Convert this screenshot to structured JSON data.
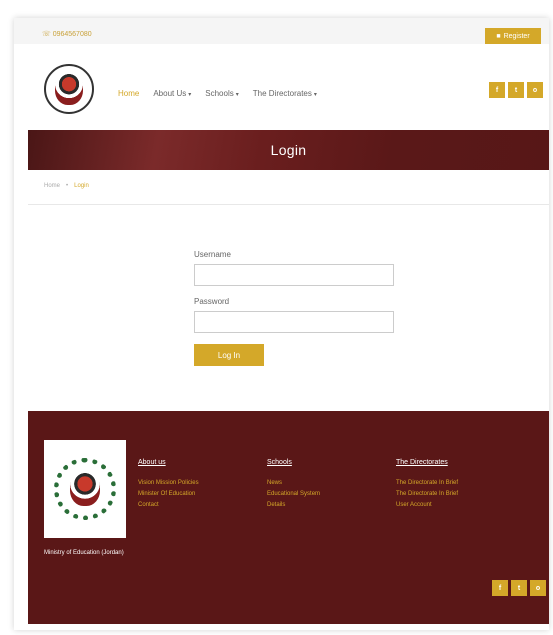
{
  "topbar": {
    "phone": "☏ 0964567080",
    "register_label": "Register"
  },
  "nav": {
    "items": [
      {
        "label": "Home",
        "active": true
      },
      {
        "label": "About Us",
        "caret": "▾"
      },
      {
        "label": "Schools",
        "caret": "▾"
      },
      {
        "label": "The Directorates",
        "caret": "▾"
      }
    ]
  },
  "social": [
    "f",
    "t",
    "o"
  ],
  "page": {
    "title": "Login"
  },
  "breadcrumb": {
    "home": "Home",
    "separator": "•",
    "current": "Login"
  },
  "login_form": {
    "username_label": "Username",
    "password_label": "Password",
    "username_value": "",
    "password_value": "",
    "submit_label": "Log In"
  },
  "footer": {
    "org_name": "Ministry of Education (Jordan)",
    "columns": [
      {
        "title": "About us",
        "links": [
          "Vision Mission Policies",
          "Minister Of Education",
          "Contact"
        ]
      },
      {
        "title": "Schools",
        "links": [
          "News",
          "Educational System",
          "Details"
        ]
      },
      {
        "title": "The Directorates",
        "links": [
          "The Directorate In Brief",
          "The Directorate In Brief",
          "User Account"
        ]
      }
    ]
  },
  "colors": {
    "accent": "#d4a829",
    "maroon": "#5a1717"
  }
}
